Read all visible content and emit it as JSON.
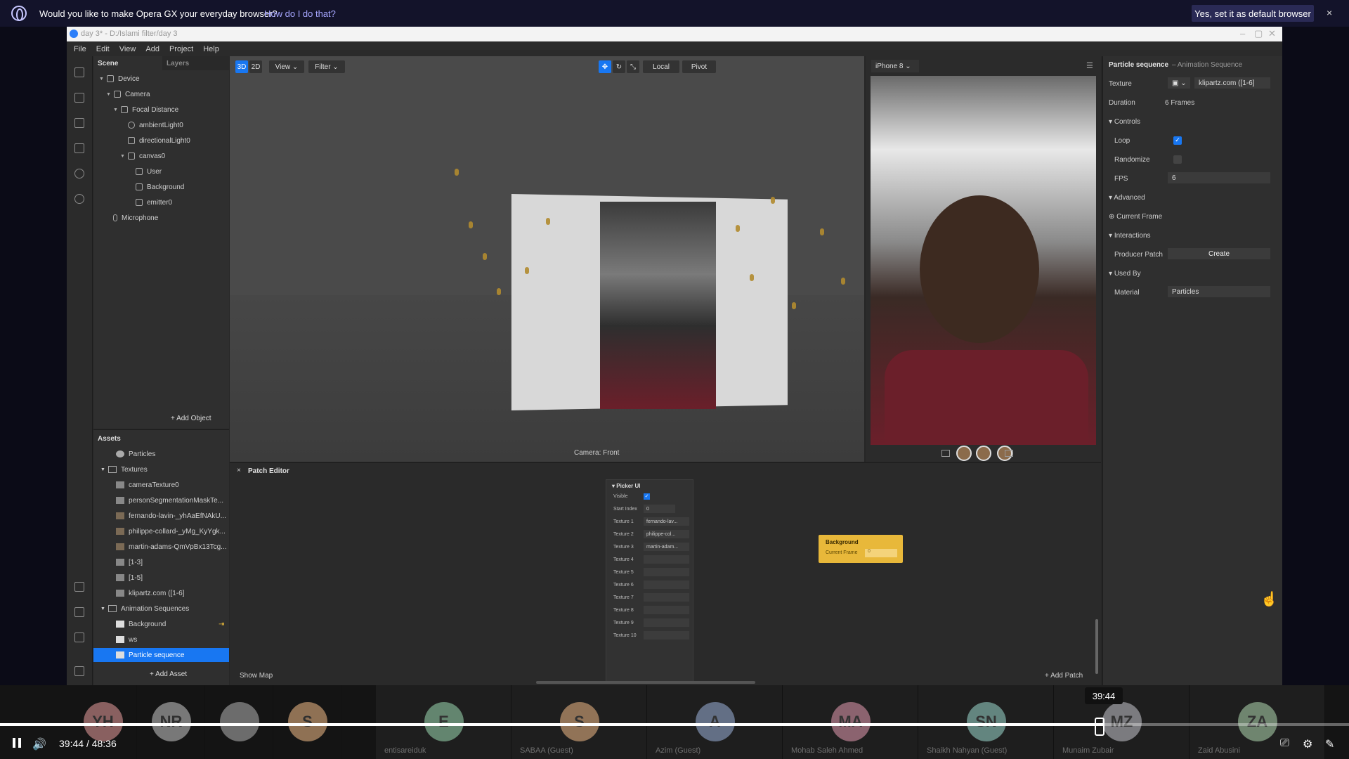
{
  "opera_bar": {
    "message": "Would you like to make Opera GX your everyday browser?",
    "link": "How do I do that?",
    "button": "Yes, set it as default browser",
    "close": "×"
  },
  "window": {
    "title": "day 3* - D:/Islami filter/day 3",
    "menu": [
      "File",
      "Edit",
      "View",
      "Add",
      "Project",
      "Help"
    ]
  },
  "scene": {
    "tabs": [
      "Scene",
      "Layers"
    ],
    "tree": [
      {
        "label": "Device"
      },
      {
        "label": "Camera"
      },
      {
        "label": "Focal Distance"
      },
      {
        "label": "ambientLight0"
      },
      {
        "label": "directionalLight0"
      },
      {
        "label": "canvas0"
      },
      {
        "label": "User"
      },
      {
        "label": "Background"
      },
      {
        "label": "emitter0"
      },
      {
        "label": "Microphone"
      }
    ],
    "add_object": "+ Add Object"
  },
  "assets": {
    "title": "Assets",
    "items": [
      {
        "label": "Particles"
      },
      {
        "label": "Textures"
      },
      {
        "label": "cameraTexture0"
      },
      {
        "label": "personSegmentationMaskTe..."
      },
      {
        "label": "fernando-lavin-_yhAaEfNAkU..."
      },
      {
        "label": "philippe-collard-_yMg_KyYgk..."
      },
      {
        "label": "martin-adams-QmVpBx13Tcg..."
      },
      {
        "label": "[1-3]"
      },
      {
        "label": "[1-5]"
      },
      {
        "label": "klipartz.com ([1-6]"
      },
      {
        "label": "Animation Sequences"
      },
      {
        "label": "Background"
      },
      {
        "label": "ws"
      },
      {
        "label": "Particle sequence"
      }
    ],
    "add_asset": "+ Add Asset"
  },
  "viewport": {
    "mode_3d": "3D",
    "mode_2d": "2D",
    "view": "View",
    "filter": "Filter",
    "local": "Local",
    "pivot": "Pivot",
    "camera_label": "Camera: Front"
  },
  "simulator": {
    "device": "iPhone 8"
  },
  "inspector": {
    "title": "Particle sequence",
    "subtitle": "– Animation Sequence",
    "texture_label": "Texture",
    "texture_value": "klipartz.com ([1-6]",
    "duration_label": "Duration",
    "duration_value": "6 Frames",
    "controls_section": "Controls",
    "loop_label": "Loop",
    "randomize_label": "Randomize",
    "fps_label": "FPS",
    "fps_value": "6",
    "advanced_section": "Advanced",
    "current_frame": "Current Frame",
    "interactions_section": "Interactions",
    "producer_patch_label": "Producer Patch",
    "create_button": "Create",
    "used_by_section": "Used By",
    "material_label": "Material",
    "material_value": "Particles"
  },
  "patch_editor": {
    "close": "×",
    "title": "Patch Editor",
    "picker": {
      "title": "Picker UI",
      "visible_label": "Visible",
      "start_index_label": "Start Index",
      "start_index_value": "0",
      "textures": [
        {
          "label": "Texture 1",
          "value": "fernando-lav..."
        },
        {
          "label": "Texture 2",
          "value": "philippe-col..."
        },
        {
          "label": "Texture 3",
          "value": "martin-adam..."
        },
        {
          "label": "Texture 4",
          "value": ""
        },
        {
          "label": "Texture 5",
          "value": ""
        },
        {
          "label": "Texture 6",
          "value": ""
        },
        {
          "label": "Texture 7",
          "value": ""
        },
        {
          "label": "Texture 8",
          "value": ""
        },
        {
          "label": "Texture 9",
          "value": ""
        },
        {
          "label": "Texture 10",
          "value": ""
        }
      ]
    },
    "background_node": {
      "title": "Background",
      "port": "Current Frame",
      "value": "0"
    },
    "show_map": "Show Map",
    "add_patch": "+ Add Patch"
  },
  "participants": [
    {
      "initials": "YH",
      "name": "",
      "color": "#b07a7a"
    },
    {
      "initials": "NR",
      "name": "",
      "color": "#9a9a9a"
    },
    {
      "initials": "",
      "name": "",
      "color": "#8a8a8a"
    },
    {
      "initials": "S",
      "name": "",
      "color": "#b8906a"
    },
    {
      "initials": "E",
      "name": "entisareiduk",
      "color": "#7aa88a"
    },
    {
      "initials": "S",
      "name": "SABAA (Guest)",
      "color": "#b8906a"
    },
    {
      "initials": "A",
      "name": "Azim (Guest)",
      "color": "#7a8aa8"
    },
    {
      "initials": "MA",
      "name": "Mohab   Saleh Ahmed",
      "color": "#b07a8a"
    },
    {
      "initials": "SN",
      "name": "Shaikh Nahyan (Guest)",
      "color": "#7aa8a0"
    },
    {
      "initials": "MZ",
      "name": "Munaim Zubair",
      "color": "#9a9aa0"
    },
    {
      "initials": "ZA",
      "name": "Zaid Abusini",
      "color": "#8aa88a"
    }
  ],
  "player": {
    "current_time": "39:44",
    "total_time": "48:36",
    "time_separator": "/",
    "tooltip": "39:44",
    "progress": 0.8176
  }
}
